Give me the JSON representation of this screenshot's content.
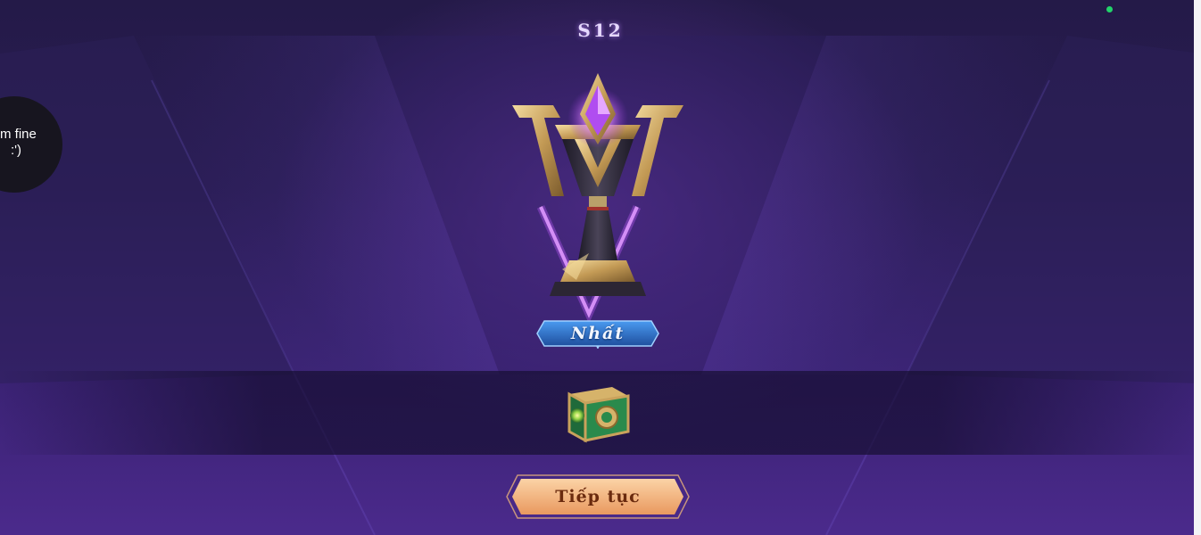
{
  "season": {
    "label": "S12"
  },
  "rank": {
    "name": "Nhất"
  },
  "reward": {
    "icon": "treasure-chest-icon"
  },
  "actions": {
    "continue_label": "Tiếp tục"
  },
  "overlay": {
    "line1": "m fine",
    "line2": ":')"
  },
  "colors": {
    "background_top": "#241a48",
    "background_bottom": "#4b2a8c",
    "trophy_gold": "#c9a25c",
    "trophy_gem": "#c66bff",
    "rank_banner_blue": "#2e6fc9",
    "button_orange": "#f2b27a",
    "button_text": "#6a2a0e",
    "status_dot": "#22d36a"
  }
}
